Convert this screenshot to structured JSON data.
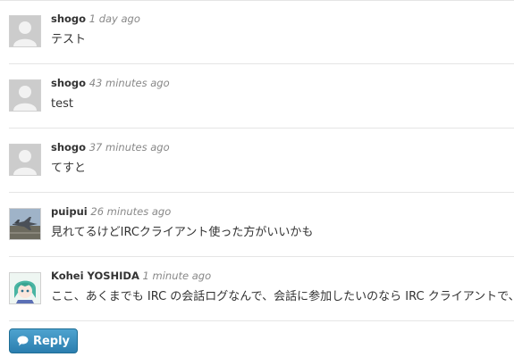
{
  "comments": [
    {
      "author": "shogo",
      "time": "1 day ago",
      "body": "テスト",
      "avatar": "default-avatar-icon"
    },
    {
      "author": "shogo",
      "time": "43 minutes ago",
      "body": "test",
      "avatar": "default-avatar-icon"
    },
    {
      "author": "shogo",
      "time": "37 minutes ago",
      "body": "てすと",
      "avatar": "default-avatar-icon"
    },
    {
      "author": "puipui",
      "time": "26 minutes ago",
      "body": "見れてるけどIRCクライアント使った方がいいかも",
      "avatar": "jet-photo-avatar"
    },
    {
      "author": "Kohei YOSHIDA",
      "time": "1 minute ago",
      "body": "ここ、あくまでも IRC の会話ログなんで、会話に参加したいのなら IRC クライアントで、",
      "avatar": "anime-character-avatar"
    }
  ],
  "reply": {
    "label": "Reply",
    "icon": "speech-bubble-icon",
    "color": "#2b7eaf"
  }
}
